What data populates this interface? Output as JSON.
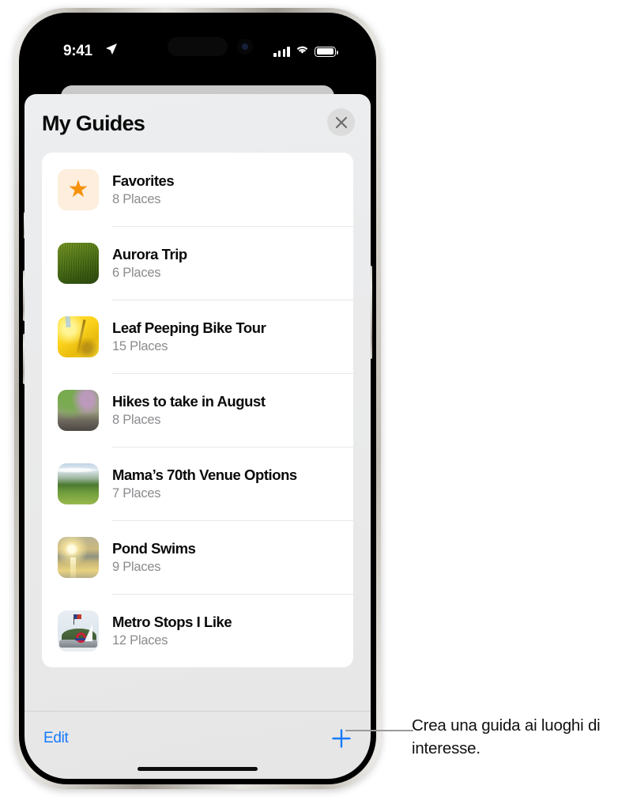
{
  "status_bar": {
    "time": "9:41",
    "location_icon": "location-arrow-icon",
    "cellular_icon": "cellular-signal-icon",
    "wifi_icon": "wifi-icon",
    "battery_icon": "battery-full-icon"
  },
  "sheet": {
    "title": "My Guides",
    "close_label": "close-icon"
  },
  "guides": [
    {
      "title": "Favorites",
      "places": "8 Places",
      "thumb": "star-tile",
      "thumb_class": "t-fav"
    },
    {
      "title": "Aurora Trip",
      "places": "6 Places",
      "thumb": "grass-photo",
      "thumb_class": "t-grass"
    },
    {
      "title": "Leaf Peeping Bike Tour",
      "places": "15 Places",
      "thumb": "yellow-leaves-photo",
      "thumb_class": "t-leaf"
    },
    {
      "title": "Hikes to take in August",
      "places": "8 Places",
      "thumb": "forest-trail-photo",
      "thumb_class": "t-hike"
    },
    {
      "title": "Mama’s 70th Venue Options",
      "places": "7 Places",
      "thumb": "meadow-photo",
      "thumb_class": "t-venue"
    },
    {
      "title": "Pond Swims",
      "places": "9 Places",
      "thumb": "sunset-pond-photo",
      "thumb_class": "t-pond"
    },
    {
      "title": "Metro Stops I Like",
      "places": "12 Places",
      "thumb": "metro-monument-photo",
      "thumb_class": "t-metro"
    }
  ],
  "toolbar": {
    "edit_label": "Edit",
    "add_label": "plus-icon"
  },
  "callout": {
    "text": "Crea una guida ai luoghi di interesse."
  },
  "colors": {
    "accent_blue": "#1479ff",
    "star_orange": "#f5920b",
    "sheet_bg": "#eaebec",
    "card_bg": "#ffffff",
    "subtitle_gray": "#8b8b8f"
  }
}
